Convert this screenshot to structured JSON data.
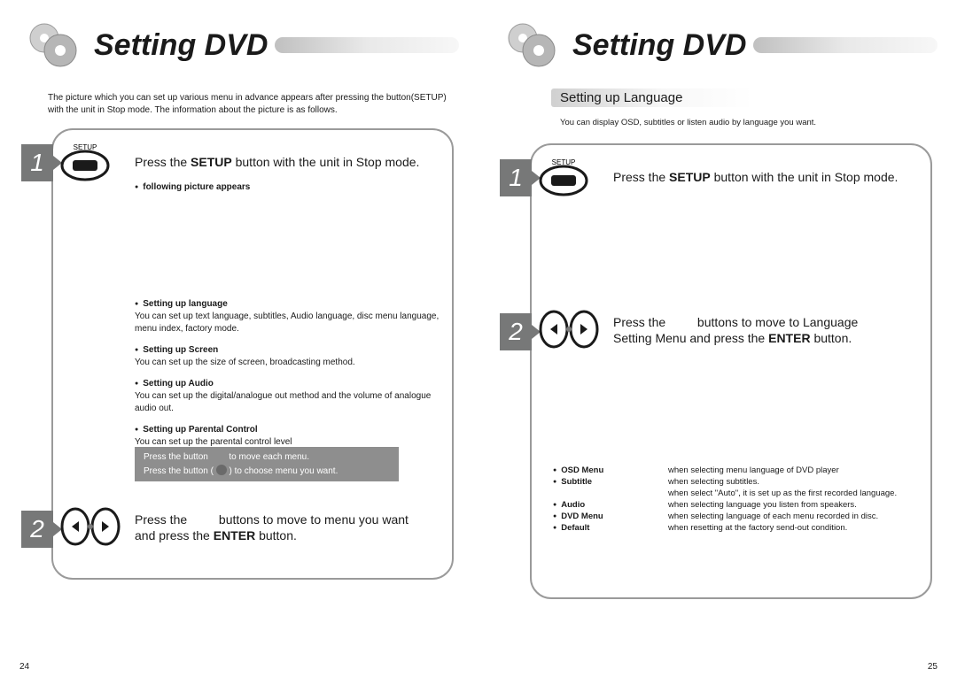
{
  "left": {
    "title": "Setting DVD",
    "intro": "The picture which you can set up various menu in advance appears after pressing the button(SETUP) with the unit in Stop mode. The information about the picture is as follows.",
    "step1": {
      "num": "1",
      "setup_label": "SETUP",
      "text_pre": "Press the ",
      "text_bold": "SETUP",
      "text_post": " button with the unit in Stop mode.",
      "note": "following picture appears"
    },
    "bullets": {
      "b1_title": "Setting up language",
      "b1_body": "You can set up text language, subtitles, Audio language, disc menu language, menu index, factory mode.",
      "b2_title": "Setting up Screen",
      "b2_body": "You can set up the size of screen, broadcasting method.",
      "b3_title": "Setting up Audio",
      "b3_body": "You can set up the digital/analogue out method and the volume of analogue audio out.",
      "b4_title": "Setting up Parental Control",
      "b4_body": "You can set up the parental control level"
    },
    "tip": {
      "line1_pre": "Press the button ",
      "line1_post": " to move each menu.",
      "line2_pre": "Press the button ( ",
      "line2_post": " ) to choose menu you want."
    },
    "step2": {
      "num": "2",
      "text_line1_pre": "Press the ",
      "text_line1_post": " buttons to move to menu you want",
      "text_line2_pre": "and press the ",
      "text_line2_bold": "ENTER",
      "text_line2_post": " button."
    },
    "pagenum": "24"
  },
  "right": {
    "title": "Setting DVD",
    "subsection": "Setting up Language",
    "sub_desc": "You can display OSD, subtitles or listen audio by language you want.",
    "step1": {
      "num": "1",
      "setup_label": "SETUP",
      "text_pre": "Press the ",
      "text_bold": "SETUP",
      "text_post": " button with the unit in Stop mode."
    },
    "step2": {
      "num": "2",
      "text_line1_pre": "Press the ",
      "text_line1_post": " buttons to move to Language",
      "text_line2_pre": "Setting Menu and press the ",
      "text_line2_bold": "ENTER",
      "text_line2_post": " button."
    },
    "table": {
      "r1_lbl": "OSD Menu",
      "r1_desc": "when selecting menu language of DVD player",
      "r2_lbl": "Subtitle",
      "r2_desc": "when selecting subtitles.",
      "r2b_desc": "when select \"Auto\", it is set up as the first recorded language.",
      "r3_lbl": "Audio",
      "r3_desc": "when selecting language you listen from speakers.",
      "r4_lbl": "DVD Menu",
      "r4_desc": "when selecting language of each menu recorded in disc.",
      "r5_lbl": "Default",
      "r5_desc": "when resetting at the factory send-out condition."
    },
    "pagenum": "25"
  }
}
